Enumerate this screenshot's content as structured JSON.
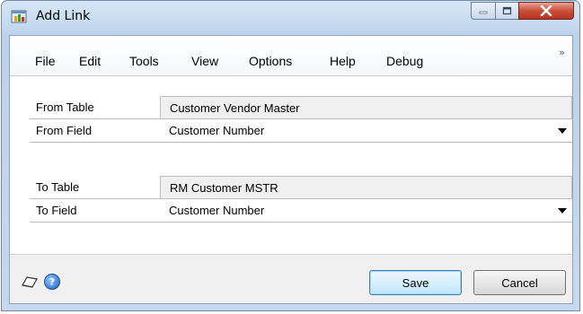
{
  "window": {
    "title": "Add Link"
  },
  "menu": {
    "items": [
      "File",
      "Edit",
      "Tools",
      "View",
      "Options",
      "Help",
      "Debug"
    ],
    "overflow": "»"
  },
  "form": {
    "from_table_label": "From Table",
    "from_table_value": "Customer Vendor Master",
    "from_field_label": "From Field",
    "from_field_value": "Customer Number",
    "to_table_label": "To Table",
    "to_table_value": "RM Customer MSTR",
    "to_field_label": "To Field",
    "to_field_value": "Customer Number"
  },
  "buttons": {
    "save": "Save",
    "cancel": "Cancel"
  },
  "icons": {
    "app": "add-link-app-icon",
    "note": "note-icon",
    "help": "help-icon",
    "help_glyph": "?"
  },
  "colors": {
    "close_button": "#c8503a",
    "title_bar": "#c3d8ee",
    "help_icon": "#1d5fc6"
  }
}
